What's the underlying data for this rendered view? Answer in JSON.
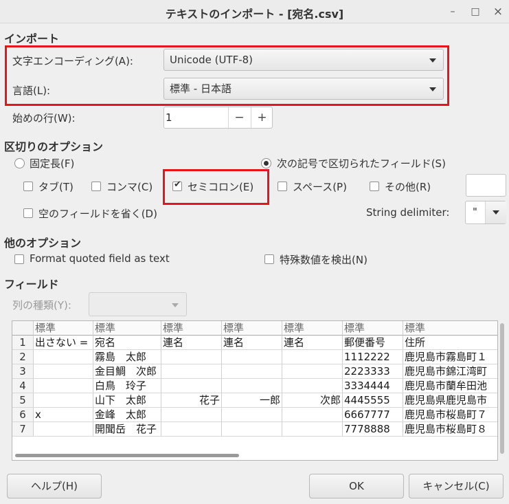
{
  "window": {
    "title": "テキストのインポート - [宛名.csv]",
    "minimize": "–",
    "maximize": "□",
    "close": "×"
  },
  "import": {
    "section": "インポート",
    "charset_label": "文字エンコーディング(A):",
    "charset_value": "Unicode (UTF-8)",
    "language_label": "言語(L):",
    "language_value": "標準 - 日本語",
    "from_row_label": "始めの行(W):",
    "from_row_value": "1",
    "minus": "−",
    "plus": "+"
  },
  "separator": {
    "section": "区切りのオプション",
    "fixed_width": "固定長(F)",
    "separated_by": "次の記号で区切られたフィールド(S)",
    "tab": "タブ(T)",
    "comma": "コンマ(C)",
    "semicolon": "セミコロン(E)",
    "space": "スペース(P)",
    "other": "その他(R)",
    "merge_delimiters": "空のフィールドを省く(D)",
    "string_delimiter_label": "String delimiter:",
    "string_delimiter_value": "\""
  },
  "other": {
    "section": "他のオプション",
    "quoted_as_text": "Format quoted field as text",
    "detect_special": "特殊数値を検出(N)"
  },
  "fields": {
    "section": "フィールド",
    "column_type_label": "列の種類(Y):",
    "headers": [
      "標準",
      "標準",
      "標準",
      "標準",
      "標準",
      "標準",
      "標準"
    ],
    "rows": [
      [
        "1",
        "出さない =",
        "宛名",
        "連名",
        "連名",
        "連名",
        "郵便番号",
        "住所"
      ],
      [
        "2",
        "",
        "霧島　太郎",
        "",
        "",
        "",
        "1112222",
        "鹿児島市霧島町１"
      ],
      [
        "3",
        "",
        "金目鯛　次郎",
        "",
        "",
        "",
        "2223333",
        "鹿児島市錦江湾町"
      ],
      [
        "4",
        "",
        "白鳥　玲子",
        "",
        "",
        "",
        "3334444",
        "鹿児島市蘭牟田池"
      ],
      [
        "5",
        "",
        "山下　太郎",
        "花子",
        "一郎",
        "次郎",
        "4445555",
        "鹿児島県鹿児島市"
      ],
      [
        "6",
        "x",
        "金峰　太郎",
        "",
        "",
        "",
        "6667777",
        "鹿児島市桜島町７"
      ],
      [
        "7",
        "",
        "開聞岳　花子",
        "",
        "",
        "",
        "7778888",
        "鹿児島市桜島町８"
      ]
    ]
  },
  "buttons": {
    "help": "ヘルプ(H)",
    "ok": "OK",
    "cancel": "キャンセル(C)"
  }
}
